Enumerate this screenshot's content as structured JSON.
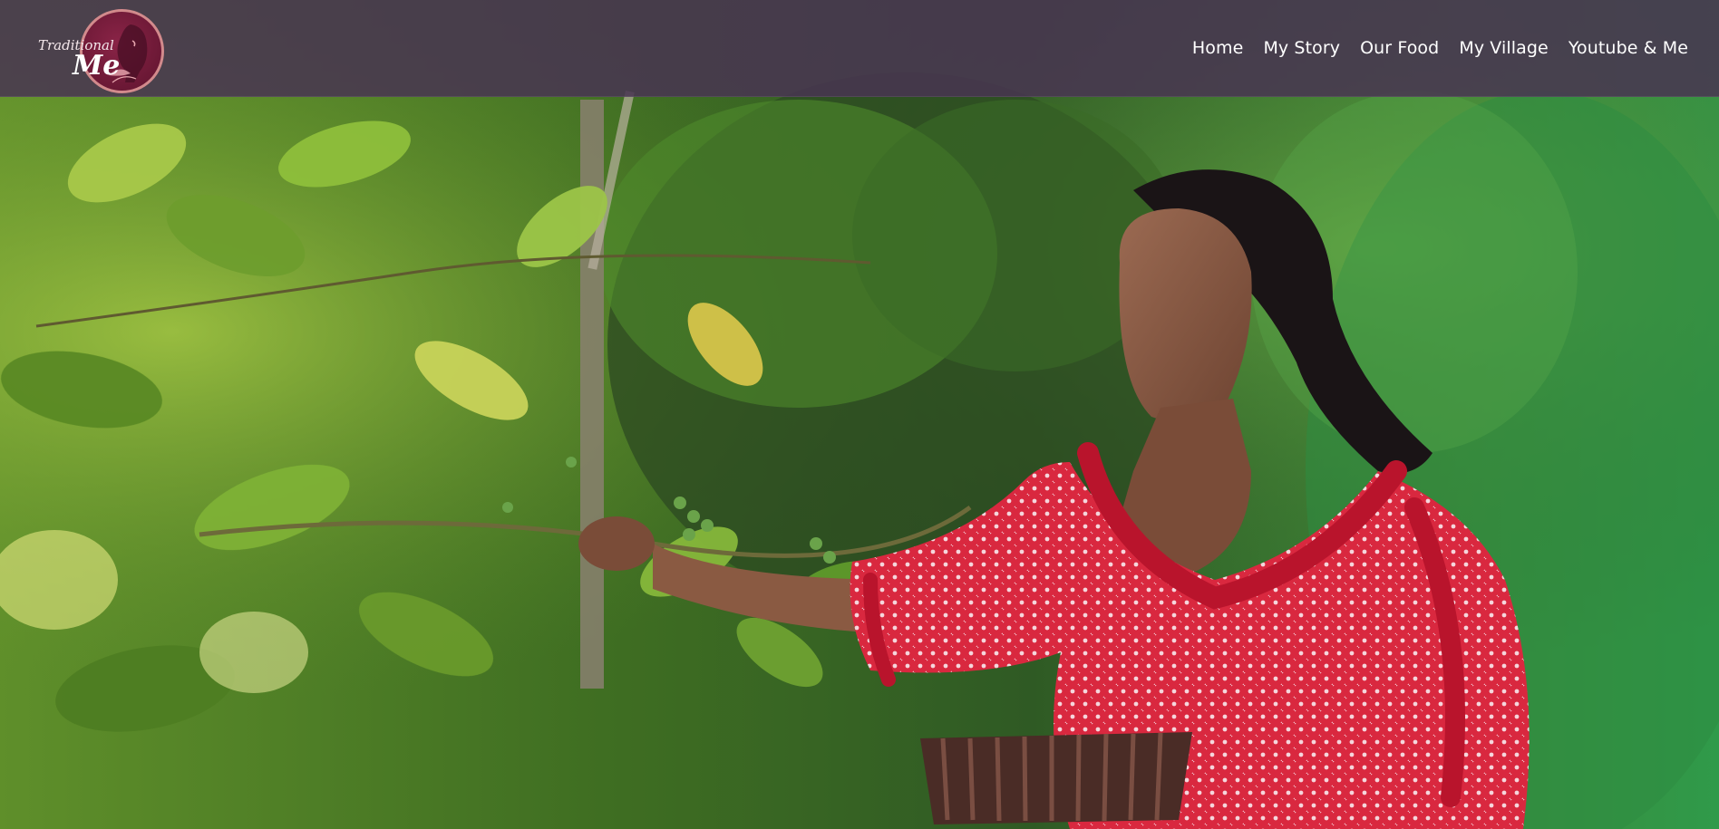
{
  "site": {
    "logo": {
      "text_top": "Traditional",
      "text_main": "Me",
      "accent_color": "#7a1d3f"
    }
  },
  "nav": {
    "items": [
      {
        "label": "Home"
      },
      {
        "label": "My Story"
      },
      {
        "label": "Our Food"
      },
      {
        "label": "My Village"
      },
      {
        "label": "Youtube & Me"
      }
    ]
  },
  "colors": {
    "navbar_bg": "#483452",
    "nav_text": "#ffffff",
    "dress_red": "#d9263f"
  }
}
